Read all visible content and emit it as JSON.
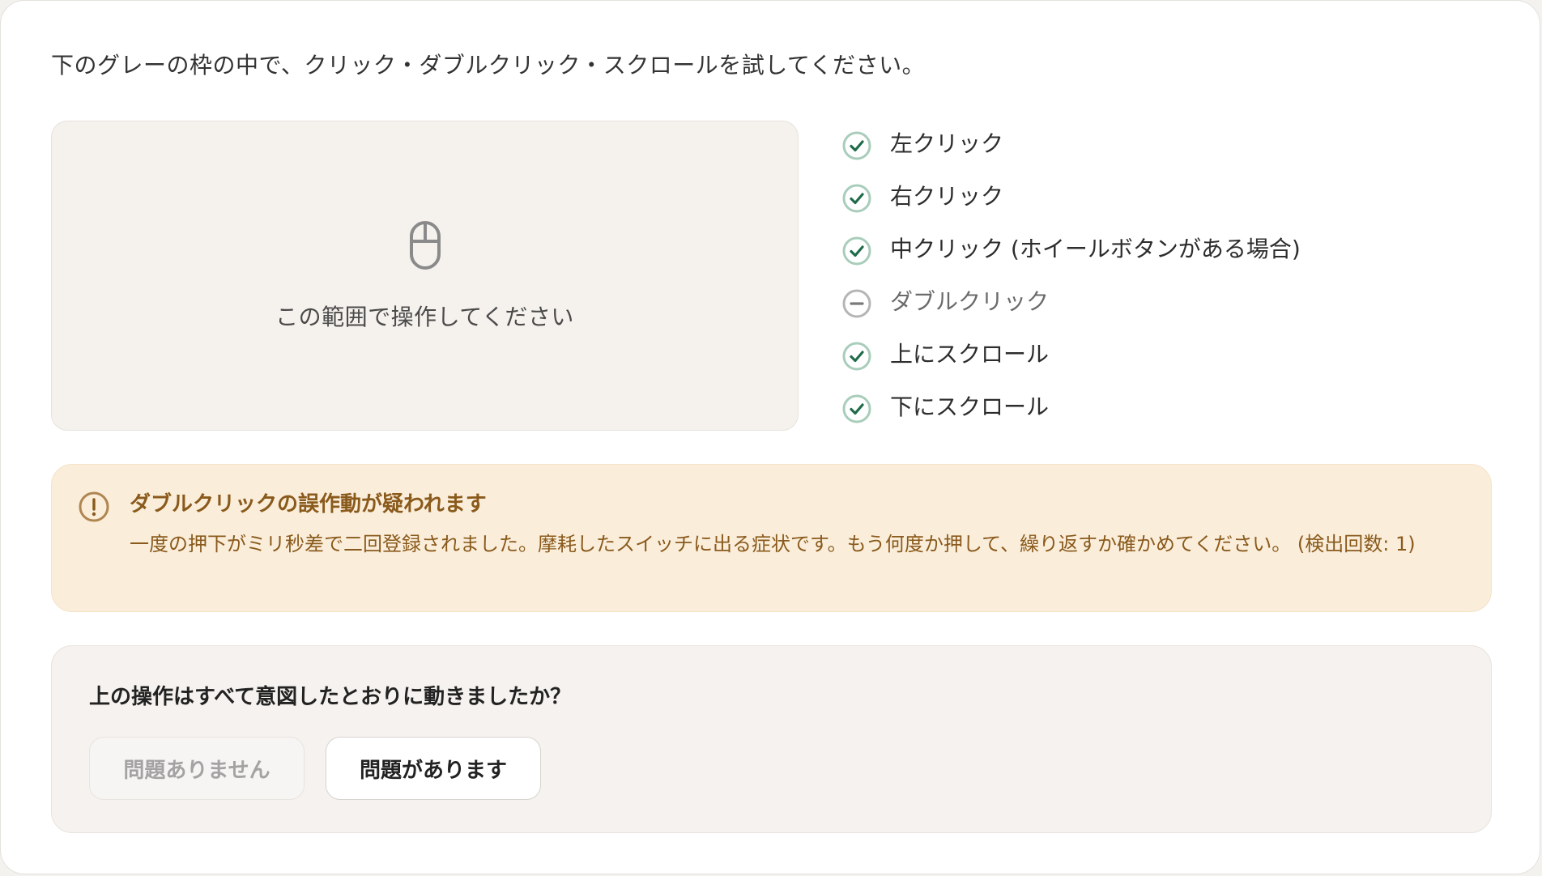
{
  "instruction": "下のグレーの枠の中で、クリック・ダブルクリック・スクロールを試してください。",
  "test_area": {
    "icon": "mouse-icon",
    "label": "この範囲で操作してください"
  },
  "checklist": [
    {
      "label": "左クリック",
      "status": "done"
    },
    {
      "label": "右クリック",
      "status": "done"
    },
    {
      "label": "中クリック (ホイールボタンがある場合)",
      "status": "done"
    },
    {
      "label": "ダブルクリック",
      "status": "pending"
    },
    {
      "label": "上にスクロール",
      "status": "done"
    },
    {
      "label": "下にスクロール",
      "status": "done"
    }
  ],
  "alert": {
    "icon": "exclamation-circle-icon",
    "title": "ダブルクリックの誤作動が疑われます",
    "body": "一度の押下がミリ秒差で二回登録されました。摩耗したスイッチに出る症状です。もう何度か押して、繰り返すか確かめてください。 (検出回数: 1)"
  },
  "question": {
    "text": "上の操作はすべて意図したとおりに動きましたか？",
    "no_problem_label": "問題ありません",
    "has_problem_label": "問題があります"
  },
  "colors": {
    "check_done": "#1f6b4a",
    "check_ring": "#a9cdbb",
    "pending_ring": "#b5b5b5",
    "alert_bg": "#faeedb",
    "alert_text": "#8a5a1c"
  }
}
